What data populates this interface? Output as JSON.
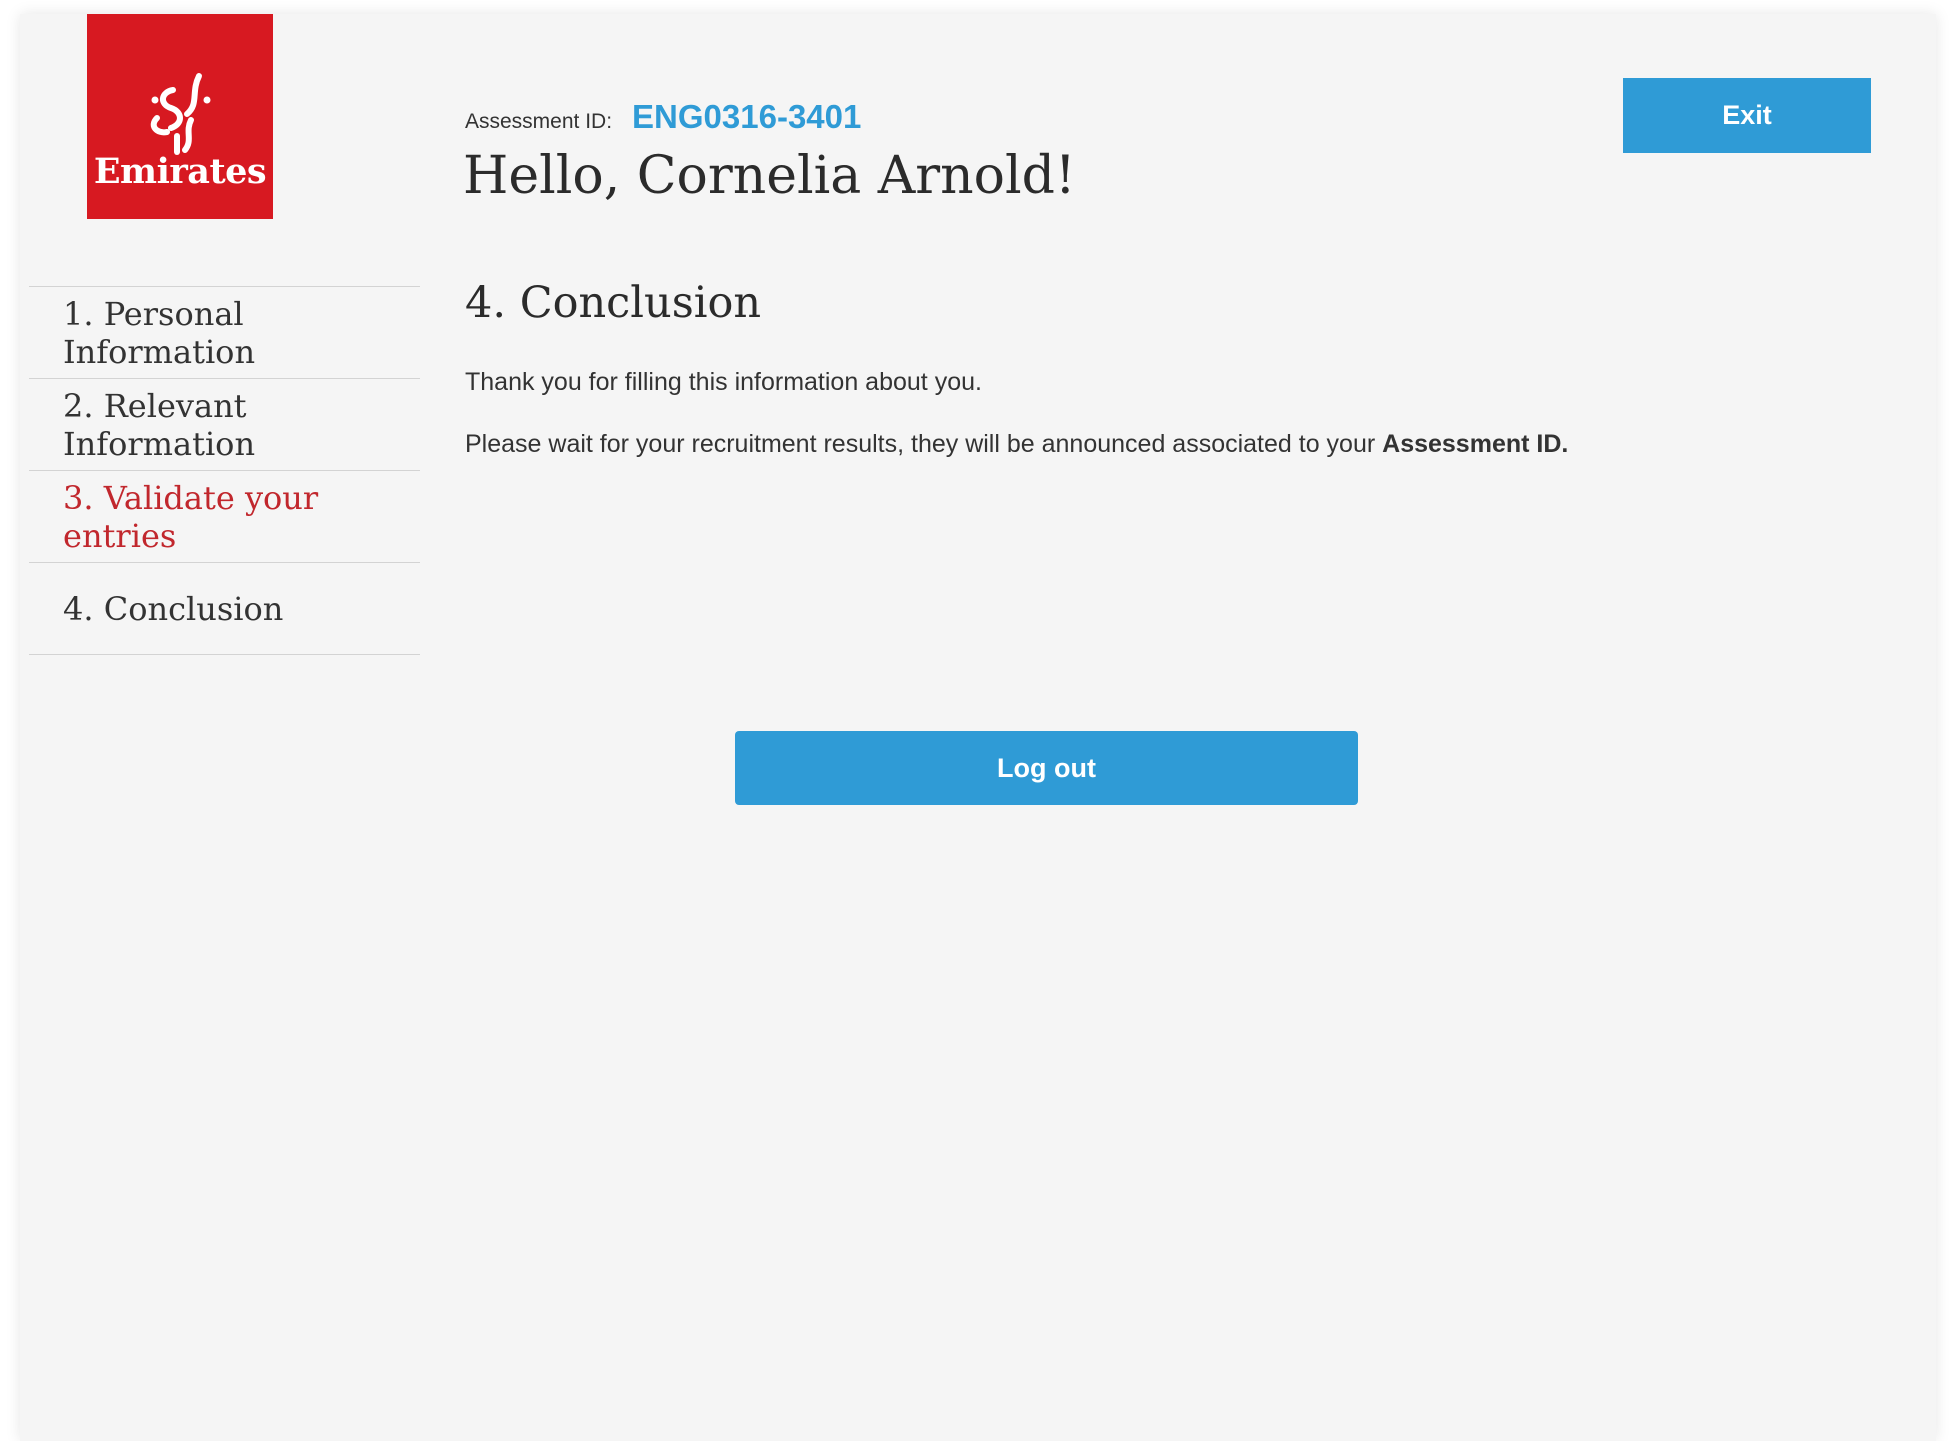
{
  "brand": {
    "logo_text": "Emirates",
    "logo_color": "#d71921"
  },
  "header": {
    "assessment_label": "Assessment ID:",
    "assessment_id": "ENG0316-3401",
    "greeting": "Hello, Cornelia Arnold!",
    "exit_label": "Exit"
  },
  "sidebar": {
    "items": [
      {
        "label": "1. Personal Information",
        "active": false
      },
      {
        "label": "2. Relevant Information",
        "active": false
      },
      {
        "label": "3. Validate your entries",
        "active": true
      },
      {
        "label": "4. Conclusion",
        "active": false
      }
    ]
  },
  "main": {
    "section_title": "4. Conclusion",
    "thank_you": "Thank you for filling this information about you.",
    "wait_text": "Please wait for your recruitment results, they will be announced associated to your ",
    "wait_emphasis": "Assessment ID.",
    "logout_label": "Log out"
  },
  "colors": {
    "accent": "#2f9bd6",
    "active_nav": "#c1272d",
    "background": "#f5f5f5"
  }
}
